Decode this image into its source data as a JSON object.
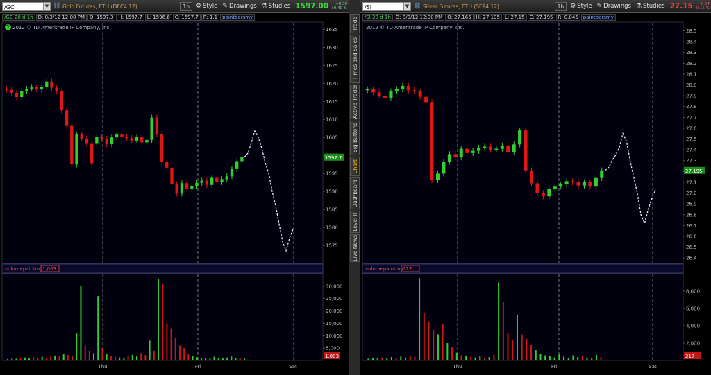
{
  "tabs": [
    "Trade",
    "Times and Sales",
    "Active Trader",
    "Big Buttons",
    "Chart",
    "Dashboard",
    "Level II",
    "Live News"
  ],
  "active_tab": "Chart",
  "panels": [
    {
      "id": "left",
      "symbol": "/GC",
      "description": "Gold Futures, ETH (DEC4 12)",
      "aggregation": "1h",
      "buttons": {
        "style": "Style",
        "drawings": "Drawings",
        "studies": "Studies"
      },
      "last_price": "1597.00",
      "price_color": "#3fd43f",
      "change_up": "+0.30",
      "change_pct": "+0.40 %",
      "change_color": "#8ed08e",
      "info": {
        "name": "/GC 20 d 1h",
        "date": "D: 8/3/12 12:00 PM",
        "open": "O: 1597.3",
        "high": "H: 1597.7",
        "low": "L: 1596.6",
        "close": "C: 1597.7",
        "range": "R: 1.1",
        "study": "paintbarsmy"
      },
      "copyright": "2012 © TD Ameritrade IP Company, Inc.",
      "badge": "1",
      "volume_label": "volumepaintmy",
      "volume_value": "1,003",
      "price_label_value": "1597.7",
      "price_label_color": "#1a8f1a",
      "vol_label_color": "#c01818",
      "x_labels": [
        "Thu",
        "Fri",
        "Sat"
      ]
    },
    {
      "id": "right",
      "symbol": "/SI",
      "description": "Silver Futures, ETH (SEP4 12)",
      "aggregation": "1h",
      "buttons": {
        "style": "Style",
        "drawings": "Drawings",
        "studies": "Studies"
      },
      "last_price": "27.15",
      "price_color": "#ff3b3b",
      "change_up": "-0.04",
      "change_pct": "-0.15 %",
      "change_color": "#e06060",
      "info": {
        "name": "/SI 20 d 1h",
        "date": "D: 8/3/12 12:00 PM",
        "open": "O: 27.165",
        "high": "H: 27.195",
        "low": "L: 27.15",
        "close": "C: 27.195",
        "range": "R: 0.045",
        "study": "paintbarsmy"
      },
      "copyright": "2012 © TD Ameritrade IP Company, Inc.",
      "badge": "",
      "volume_label": "volumepaintmy",
      "volume_value": "217",
      "price_label_value": "27.195",
      "price_label_color": "#1a8f1a",
      "vol_label_color": "#c01818",
      "x_labels": [
        "Thu",
        "Fri",
        "Sat"
      ]
    }
  ],
  "chart_data": [
    {
      "type": "candlestick",
      "title": "/GC 20 d 1h",
      "ylim": [
        1570,
        1637
      ],
      "y_ticks": [
        1575,
        1580,
        1585,
        1590,
        1595,
        1600,
        1605,
        1610,
        1615,
        1620,
        1625,
        1630,
        1635
      ],
      "bars": [
        [
          1618.5,
          1618.2
        ],
        [
          1618.2,
          1617.4
        ],
        [
          1617.4,
          1616.2
        ],
        [
          1616.2,
          1617.9
        ],
        [
          1617.9,
          1618.5
        ],
        [
          1618.5,
          1619.0
        ],
        [
          1619.0,
          1618.3
        ],
        [
          1618.3,
          1618.9
        ],
        [
          1618.9,
          1620.5
        ],
        [
          1620.5,
          1618.8
        ],
        [
          1618.8,
          1617.8
        ],
        [
          1617.8,
          1612.5
        ],
        [
          1612.5,
          1608.2
        ],
        [
          1608.2,
          1597.5
        ],
        [
          1597.5,
          1605.8
        ],
        [
          1605.8,
          1604.7
        ],
        [
          1604.7,
          1603.2
        ],
        [
          1603.2,
          1597.8
        ],
        [
          1603.2,
          1605.2
        ],
        [
          1605.2,
          1604.6
        ],
        [
          1604.6,
          1603.1
        ],
        [
          1603.1,
          1605.0
        ],
        [
          1605.0,
          1605.8
        ],
        [
          1605.8,
          1605.2
        ],
        [
          1605.2,
          1604.8
        ],
        [
          1604.8,
          1604.1
        ],
        [
          1604.1,
          1605.2
        ],
        [
          1605.2,
          1603.6
        ],
        [
          1603.6,
          1604.3
        ],
        [
          1604.3,
          1610.5
        ],
        [
          1610.5,
          1606.0
        ],
        [
          1606.0,
          1598.2
        ],
        [
          1598.2,
          1596.6
        ],
        [
          1596.6,
          1592.0
        ],
        [
          1592.0,
          1589.4
        ],
        [
          1589.4,
          1592.3
        ],
        [
          1592.3,
          1590.8
        ],
        [
          1590.8,
          1591.5
        ],
        [
          1591.5,
          1592.4
        ],
        [
          1592.4,
          1593.0
        ],
        [
          1593.0,
          1591.8
        ],
        [
          1591.8,
          1593.8
        ],
        [
          1593.8,
          1592.6
        ],
        [
          1592.6,
          1593.4
        ],
        [
          1593.4,
          1594.2
        ],
        [
          1594.2,
          1596.2
        ],
        [
          1596.2,
          1598.4
        ],
        [
          1598.4,
          1599.5
        ]
      ],
      "ext_line": [
        1599.5,
        1600.6,
        1603.5,
        1606.8,
        1605.0,
        1602.0,
        1598.0,
        1595.0,
        1590.0,
        1586.0,
        1581.0,
        1576.0,
        1573.5,
        1577.0,
        1579.5
      ],
      "volume_ylim": [
        0,
        35000
      ],
      "volume_ticks": [
        5000,
        10000,
        15000,
        20000,
        25000,
        30000
      ],
      "volume_ticklabels": [
        "5,000",
        "10,000",
        "15,000",
        "20,000",
        "25,000",
        "30,000"
      ],
      "volume": [
        [
          600,
          "g"
        ],
        [
          800,
          "g"
        ],
        [
          700,
          "g"
        ],
        [
          1000,
          "r"
        ],
        [
          1200,
          "g"
        ],
        [
          800,
          "g"
        ],
        [
          1300,
          "r"
        ],
        [
          900,
          "r"
        ],
        [
          1500,
          "g"
        ],
        [
          1100,
          "r"
        ],
        [
          1800,
          "r"
        ],
        [
          2000,
          "g"
        ],
        [
          1600,
          "r"
        ],
        [
          2500,
          "g"
        ],
        [
          2200,
          "r"
        ],
        [
          1900,
          "r"
        ],
        [
          11000,
          "g"
        ],
        [
          30000,
          "g"
        ],
        [
          6000,
          "r"
        ],
        [
          4000,
          "r"
        ],
        [
          3000,
          "g"
        ],
        [
          26000,
          "g"
        ],
        [
          5000,
          "r"
        ],
        [
          2500,
          "g"
        ],
        [
          1800,
          "r"
        ],
        [
          1500,
          "r"
        ],
        [
          1200,
          "g"
        ],
        [
          1000,
          "g"
        ],
        [
          1700,
          "r"
        ],
        [
          2300,
          "g"
        ],
        [
          1900,
          "g"
        ],
        [
          3000,
          "r"
        ],
        [
          2200,
          "r"
        ],
        [
          8000,
          "g"
        ],
        [
          4000,
          "r"
        ],
        [
          33000,
          "g"
        ],
        [
          31000,
          "r"
        ],
        [
          15000,
          "r"
        ],
        [
          13000,
          "r"
        ],
        [
          9000,
          "r"
        ],
        [
          6000,
          "r"
        ],
        [
          5000,
          "r"
        ],
        [
          2500,
          "r"
        ],
        [
          1700,
          "g"
        ],
        [
          1300,
          "g"
        ],
        [
          1100,
          "g"
        ],
        [
          900,
          "g"
        ],
        [
          700,
          "g"
        ],
        [
          1500,
          "g"
        ],
        [
          1000,
          "g"
        ],
        [
          800,
          "g"
        ],
        [
          1200,
          "g"
        ],
        [
          1600,
          "g"
        ],
        [
          900,
          "g"
        ],
        [
          1000,
          "r"
        ],
        [
          800,
          "g"
        ]
      ]
    },
    {
      "type": "candlestick",
      "title": "/SI 20 d 1h",
      "ylim": [
        26.35,
        28.58
      ],
      "y_ticks": [
        26.4,
        26.5,
        26.6,
        26.7,
        26.8,
        26.9,
        27.0,
        27.1,
        27.2,
        27.3,
        27.4,
        27.5,
        27.6,
        27.7,
        27.8,
        27.9,
        28.0,
        28.1,
        28.2,
        28.3,
        28.4,
        28.5
      ],
      "bars": [
        [
          27.95,
          27.96
        ],
        [
          27.96,
          27.93
        ],
        [
          27.93,
          27.9
        ],
        [
          27.9,
          27.88
        ],
        [
          27.88,
          27.94
        ],
        [
          27.94,
          27.96
        ],
        [
          27.96,
          27.99
        ],
        [
          27.99,
          27.95
        ],
        [
          27.95,
          27.94
        ],
        [
          27.94,
          27.89
        ],
        [
          27.89,
          27.84
        ],
        [
          27.84,
          27.12
        ],
        [
          27.12,
          27.18
        ],
        [
          27.18,
          27.29
        ],
        [
          27.29,
          27.36
        ],
        [
          27.36,
          27.33
        ],
        [
          27.33,
          27.41
        ],
        [
          27.41,
          27.37
        ],
        [
          27.37,
          27.39
        ],
        [
          27.39,
          27.42
        ],
        [
          27.42,
          27.43
        ],
        [
          27.43,
          27.4
        ],
        [
          27.4,
          27.41
        ],
        [
          27.41,
          27.44
        ],
        [
          27.44,
          27.38
        ],
        [
          27.38,
          27.45
        ],
        [
          27.45,
          27.58
        ],
        [
          27.58,
          27.21
        ],
        [
          27.21,
          27.09
        ],
        [
          27.09,
          27.0
        ],
        [
          27.0,
          26.97
        ],
        [
          26.97,
          27.04
        ],
        [
          27.04,
          27.06
        ],
        [
          27.06,
          27.08
        ],
        [
          27.08,
          27.11
        ],
        [
          27.11,
          27.1
        ],
        [
          27.1,
          27.07
        ],
        [
          27.07,
          27.1
        ],
        [
          27.1,
          27.06
        ],
        [
          27.06,
          27.14
        ],
        [
          27.14,
          27.21
        ]
      ],
      "ext_line": [
        27.21,
        27.23,
        27.3,
        27.35,
        27.42,
        27.55,
        27.48,
        27.3,
        27.15,
        27.0,
        26.8,
        26.72,
        26.85,
        26.95,
        27.03
      ],
      "volume_ylim": [
        0,
        10000
      ],
      "volume_ticks": [
        2000,
        4000,
        6000,
        8000
      ],
      "volume_ticklabels": [
        "2,000",
        "4,000",
        "6,000",
        "8,000"
      ],
      "volume": [
        [
          200,
          "g"
        ],
        [
          300,
          "g"
        ],
        [
          250,
          "g"
        ],
        [
          350,
          "r"
        ],
        [
          300,
          "g"
        ],
        [
          400,
          "g"
        ],
        [
          300,
          "r"
        ],
        [
          450,
          "g"
        ],
        [
          350,
          "g"
        ],
        [
          500,
          "r"
        ],
        [
          400,
          "r"
        ],
        [
          9500,
          "g"
        ],
        [
          5500,
          "r"
        ],
        [
          4500,
          "r"
        ],
        [
          3500,
          "r"
        ],
        [
          3000,
          "g"
        ],
        [
          4200,
          "r"
        ],
        [
          2000,
          "g"
        ],
        [
          1500,
          "r"
        ],
        [
          900,
          "g"
        ],
        [
          600,
          "r"
        ],
        [
          500,
          "g"
        ],
        [
          400,
          "r"
        ],
        [
          350,
          "g"
        ],
        [
          500,
          "g"
        ],
        [
          300,
          "r"
        ],
        [
          400,
          "g"
        ],
        [
          650,
          "r"
        ],
        [
          9000,
          "g"
        ],
        [
          6800,
          "r"
        ],
        [
          3200,
          "r"
        ],
        [
          2400,
          "r"
        ],
        [
          5200,
          "g"
        ],
        [
          3000,
          "r"
        ],
        [
          2500,
          "r"
        ],
        [
          1800,
          "r"
        ],
        [
          1200,
          "g"
        ],
        [
          800,
          "g"
        ],
        [
          600,
          "g"
        ],
        [
          500,
          "g"
        ],
        [
          350,
          "g"
        ],
        [
          700,
          "g"
        ],
        [
          450,
          "g"
        ],
        [
          300,
          "g"
        ],
        [
          600,
          "g"
        ],
        [
          400,
          "g"
        ],
        [
          500,
          "r"
        ],
        [
          350,
          "g"
        ],
        [
          300,
          "g"
        ],
        [
          650,
          "g"
        ],
        [
          400,
          "r"
        ]
      ]
    }
  ]
}
